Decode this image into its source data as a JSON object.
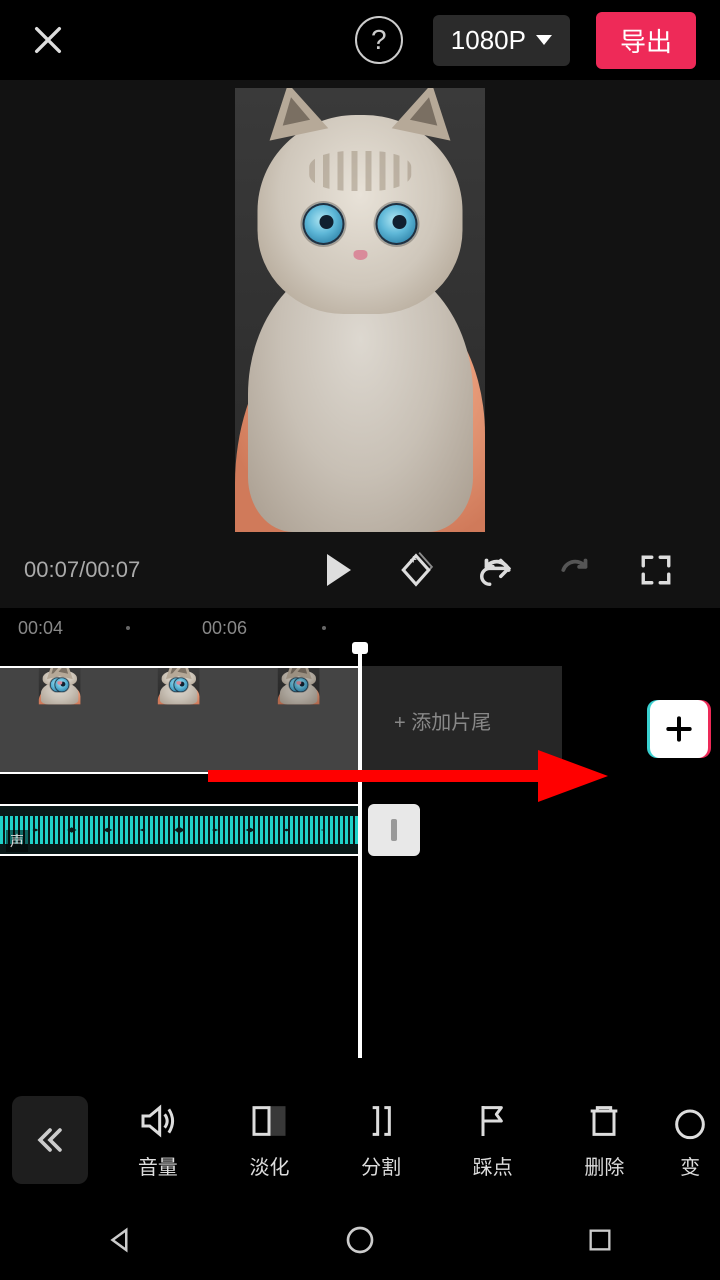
{
  "topbar": {
    "resolution": "1080P",
    "export": "导出"
  },
  "playback": {
    "current": "00:07",
    "total": "00:07"
  },
  "ruler": {
    "t1": "00:04",
    "t2": "00:06"
  },
  "timeline": {
    "ending_label": "+ 添加片尾",
    "audio_label": "声"
  },
  "tools": {
    "volume": "音量",
    "fade": "淡化",
    "split": "分割",
    "beat": "踩点",
    "delete": "删除",
    "speed": "变"
  }
}
